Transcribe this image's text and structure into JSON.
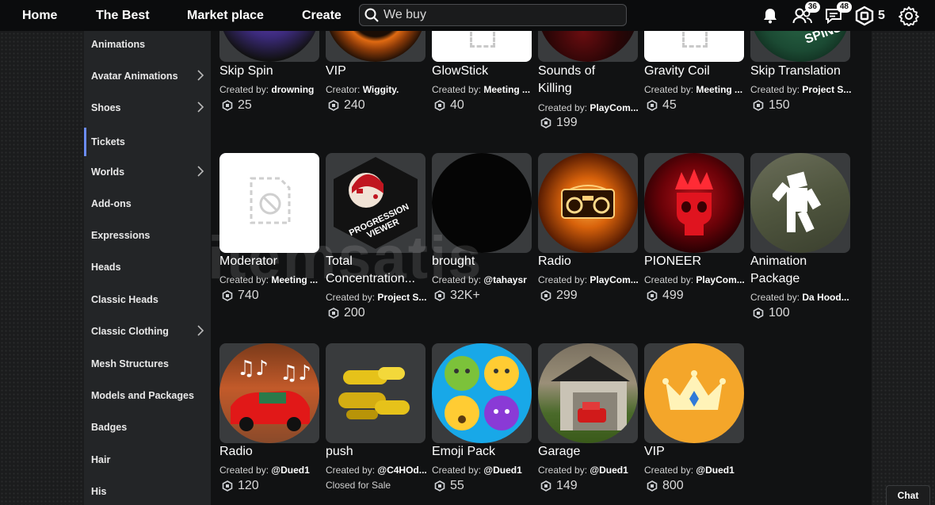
{
  "nav": {
    "home": "Home",
    "the_best": "The Best",
    "market_place": "Market place",
    "create": "Create"
  },
  "search": {
    "placeholder": "We buy"
  },
  "topbar": {
    "friends_badge": "36",
    "messages_badge": "48",
    "robux_balance": "5"
  },
  "sidebar": {
    "items": [
      {
        "label": "Animations"
      },
      {
        "label": "Avatar Animations"
      },
      {
        "label": "Shoes"
      },
      {
        "label": "Tickets"
      },
      {
        "label": "Worlds"
      },
      {
        "label": "Add-ons"
      },
      {
        "label": "Expressions"
      },
      {
        "label": "Heads"
      },
      {
        "label": "Classic Heads"
      },
      {
        "label": "Classic Clothing"
      },
      {
        "label": "Mesh Structures"
      },
      {
        "label": "Models and Packages"
      },
      {
        "label": "Badges"
      },
      {
        "label": "Hair"
      },
      {
        "label": "His"
      }
    ]
  },
  "items": [
    {
      "title": "Skip Spin",
      "creator_prefix": "Created by:",
      "creator": "drowning",
      "price": "25"
    },
    {
      "title": "VIP",
      "creator_prefix": "Creator:",
      "creator": "Wiggity.",
      "price": "240"
    },
    {
      "title": "GlowStick",
      "creator_prefix": "Created by:",
      "creator": "Meeting ...",
      "price": "40"
    },
    {
      "title": "Sounds of Killing",
      "creator_prefix": "Created by:",
      "creator": "PlayCom...",
      "price": "199"
    },
    {
      "title": "Gravity Coil",
      "creator_prefix": "Created by:",
      "creator": "Meeting ...",
      "price": "45"
    },
    {
      "title": "Skip Translation",
      "creator_prefix": "Created by:",
      "creator": "Project S...",
      "price": "150"
    },
    {
      "title": "Moderator",
      "creator_prefix": "Created by:",
      "creator": "Meeting ...",
      "price": "740"
    },
    {
      "title": "Total Concentration...",
      "creator_prefix": "Created by:",
      "creator": "Project S...",
      "price": "200"
    },
    {
      "title": "brought",
      "creator_prefix": "Created by:",
      "creator": "@tahaysr",
      "price": "32K+"
    },
    {
      "title": "Radio",
      "creator_prefix": "Created by:",
      "creator": "PlayCom...",
      "price": "299"
    },
    {
      "title": "PIONEER",
      "creator_prefix": "Created by:",
      "creator": "PlayCom...",
      "price": "499"
    },
    {
      "title": "Animation Package",
      "creator_prefix": "Created by:",
      "creator": "Da Hood...",
      "price": "100"
    },
    {
      "title": "Radio",
      "creator_prefix": "Created by:",
      "creator": "@Dued1",
      "price": "120"
    },
    {
      "title": "push",
      "creator_prefix": "Created by:",
      "creator": "@C4HOd...",
      "status": "Closed for Sale"
    },
    {
      "title": "Emoji Pack",
      "creator_prefix": "Created by:",
      "creator": "@Dued1",
      "price": "55"
    },
    {
      "title": "Garage",
      "creator_prefix": "Created by:",
      "creator": "@Dued1",
      "price": "149"
    },
    {
      "title": "VIP",
      "creator_prefix": "Created by:",
      "creator": "@Dued1",
      "price": "800"
    }
  ],
  "thumb_texts": {
    "progression_viewer": "PROGRESSION VIEWER",
    "spins": "SPINS"
  },
  "watermark": "itemsatis",
  "chat": {
    "label": "Chat"
  },
  "colors": {
    "active_indicator": "#6b8cf7",
    "topbar": "#0b0c0d",
    "sidebar": "#232527",
    "main": "#111213"
  }
}
